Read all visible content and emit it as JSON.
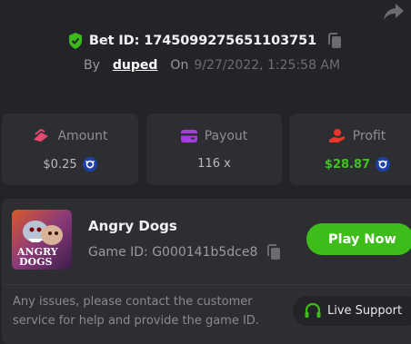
{
  "bet": {
    "id_label": "Bet ID: 1745099275651103751",
    "by_label": "By",
    "username": "duped",
    "on_label": "On",
    "datetime": "9/27/2022, 1:25:58 AM"
  },
  "stats": {
    "amount": {
      "label": "Amount",
      "value": "$0.25"
    },
    "payout": {
      "label": "Payout",
      "value": "116 x"
    },
    "profit": {
      "label": "Profit",
      "value": "$28.87"
    }
  },
  "game": {
    "title": "Angry Dogs",
    "id_label": "Game ID: G000141b5dce8",
    "thumb_line1": "ANGRY",
    "thumb_line2": "DOGS"
  },
  "actions": {
    "play_label": "Play Now",
    "support_label": "Live Support"
  },
  "footer": {
    "issue_text": "Any issues, please contact the customer service for help and provide the game ID."
  },
  "colors": {
    "background": "#232427",
    "card": "#2d2e32",
    "accent_green": "#3ebd1a",
    "amount_icon": "#e8476f",
    "payout_icon": "#a43de0",
    "profit_icon": "#e8362c",
    "coin": "#1f3fa8"
  },
  "icons": [
    "share-icon",
    "shield-check-icon",
    "copy-icon",
    "amount-icon",
    "wallet-icon",
    "profit-hand-icon",
    "coin-icon",
    "headset-icon"
  ]
}
